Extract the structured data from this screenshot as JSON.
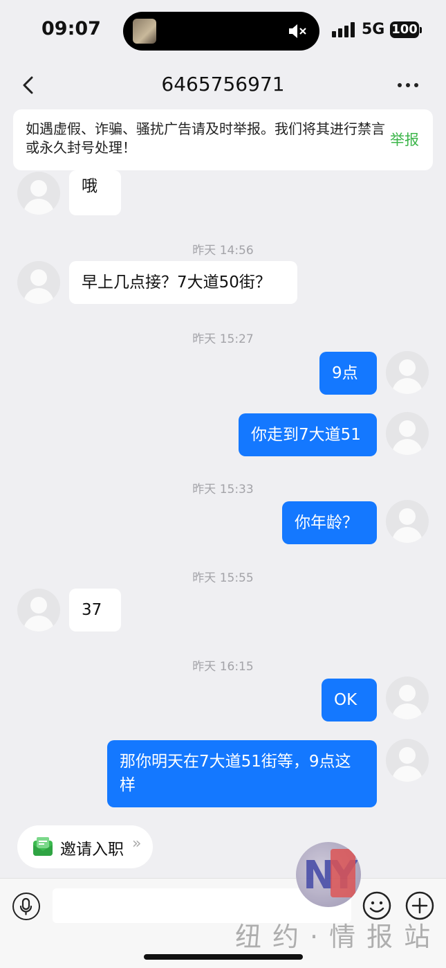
{
  "status_bar": {
    "time": "09:07",
    "network": "5G",
    "battery": "100"
  },
  "header": {
    "title": "6465756971"
  },
  "notice": {
    "text": "如遇虚假、诈骗、骚扰广告请及时举报。我们将其进行禁言或永久封号处理！",
    "report_label": "举报"
  },
  "messages": [
    {
      "type": "in",
      "text": "哦"
    },
    {
      "type": "timestamp",
      "text": "昨天 14:56"
    },
    {
      "type": "in",
      "text": "早上几点接？7大道50街？"
    },
    {
      "type": "timestamp",
      "text": "昨天 15:27"
    },
    {
      "type": "out",
      "text": "9点"
    },
    {
      "type": "out",
      "text": "你走到7大道51"
    },
    {
      "type": "timestamp",
      "text": "昨天 15:33"
    },
    {
      "type": "out",
      "text": "你年龄？"
    },
    {
      "type": "timestamp",
      "text": "昨天 15:55"
    },
    {
      "type": "in",
      "text": "37"
    },
    {
      "type": "timestamp",
      "text": "昨天 16:15"
    },
    {
      "type": "out",
      "text": "OK"
    },
    {
      "type": "out",
      "text": "那你明天在7大道51街等，9点这样"
    }
  ],
  "invite": {
    "label": "邀请入职",
    "arrow": "»"
  },
  "input": {
    "placeholder": ""
  },
  "watermark": {
    "text": "纽约·情报站",
    "logo": "NY"
  },
  "colors": {
    "outgoing_bubble": "#1478ff",
    "report_link": "#3cb54a",
    "background": "#efeff2"
  },
  "icons": [
    "back-icon",
    "more-icon",
    "mute-icon",
    "microphone-icon",
    "emoji-icon",
    "plus-icon",
    "invite-icon"
  ]
}
